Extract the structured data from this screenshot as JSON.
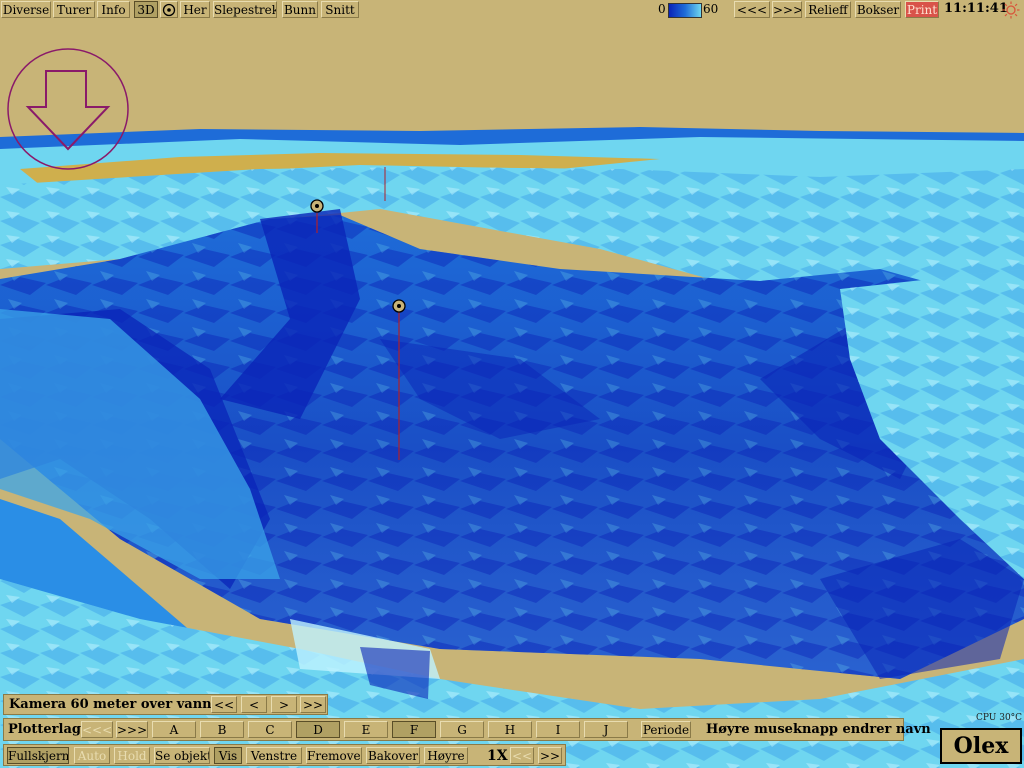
{
  "topbar": {
    "menu": [
      {
        "id": "diverse",
        "label": "Diverse"
      },
      {
        "id": "turer",
        "label": "Turer"
      },
      {
        "id": "info",
        "label": "Info"
      },
      {
        "id": "3d",
        "label": "3D"
      },
      {
        "id": "her",
        "label": "Her"
      },
      {
        "id": "slepestrek",
        "label": "Slepestrek"
      },
      {
        "id": "bunn",
        "label": "Bunn"
      },
      {
        "id": "snitt",
        "label": "Snitt"
      }
    ],
    "depth_scale": {
      "min": "0",
      "max": "60",
      "colors": [
        "#0a24b8",
        "#1e6cd8",
        "#6fd6f0"
      ]
    },
    "right": [
      {
        "id": "prev",
        "label": "<<<"
      },
      {
        "id": "next",
        "label": ">>>"
      },
      {
        "id": "relieff",
        "label": "Relieff"
      },
      {
        "id": "bokser",
        "label": "Bokser"
      },
      {
        "id": "print",
        "label": "Print"
      }
    ],
    "clock": "11:11:41"
  },
  "camera": {
    "label": "Kamera 60 meter over vann",
    "buttons": [
      "<<",
      "<",
      ">",
      ">>"
    ]
  },
  "plotterlag": {
    "label": "Plotterlag",
    "back": "<<<",
    "forward": ">>>",
    "layers": [
      "A",
      "B",
      "C",
      "D",
      "E",
      "F",
      "G",
      "H",
      "I",
      "J"
    ],
    "active_layers": [
      "D",
      "F"
    ],
    "periode": "Periode",
    "hint": "Høyre museknapp endrer navn"
  },
  "bottombar": {
    "fullskjerm": "Fullskjerm",
    "auto": "Auto",
    "hold": "Hold",
    "se_objekt": "Se objekt",
    "vis": "Vis",
    "venstre": "Venstre",
    "fremover": "Fremover",
    "bakover": "Bakover",
    "hoyre": "Høyre",
    "speed": "1X",
    "speed_down": "<<",
    "speed_up": ">>"
  },
  "cpu": "CPU 30°C",
  "brand": "Olex",
  "colors": {
    "panel": "#c8b477",
    "deep": "#0a24b8",
    "mid": "#1e6cd8",
    "shallow": "#6fd6f0",
    "marker": "#b0202a",
    "compass": "#8a1a6a"
  },
  "icons": [
    "target-icon",
    "sun-icon",
    "compass-arrow-icon",
    "marker-icon"
  ]
}
